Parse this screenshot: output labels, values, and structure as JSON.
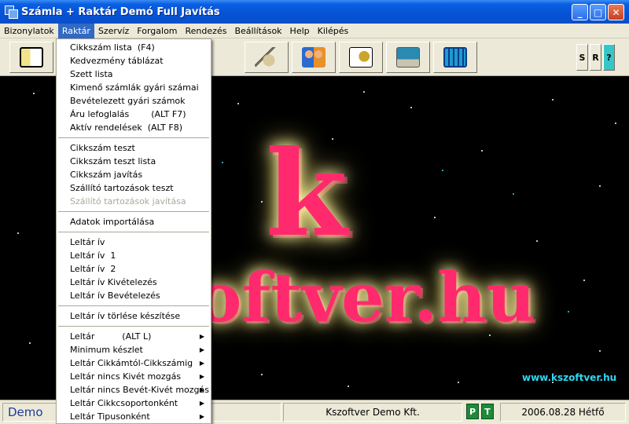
{
  "window": {
    "title": "Számla + Raktár Demó Full  Javítás"
  },
  "menubar": {
    "items": [
      "Bizonylatok",
      "Raktár",
      "Szervíz",
      "Forgalom",
      "Rendezés",
      "Beállítások",
      "Help",
      "Kilépés"
    ],
    "active": "Raktár"
  },
  "toolbar": {
    "buttons": [
      "folder-list-icon",
      "books-icon",
      "saxophone-icon",
      "users-icon",
      "gears-shortcut-icon",
      "computer-icon",
      "calculator-icon"
    ],
    "small_buttons": [
      "S",
      "R",
      "?"
    ]
  },
  "raktar_menu": {
    "group1": [
      "Cikkszám lista  (F4)",
      "Kedvezmény táblázat",
      "Szett lista",
      "Kimenő számlák gyári számai",
      "Bevételezett gyári számok",
      "Áru lefoglalás        (ALT F7)",
      "Aktív rendelések  (ALT F8)"
    ],
    "group2": [
      "Cikkszám teszt",
      "Cikkszám teszt lista",
      "Cikkszám javítás",
      "Szállító tartozások teszt"
    ],
    "group2_disabled": "Szállító tartozások javítása",
    "group3": [
      "Adatok importálása"
    ],
    "group4": [
      "Leltár ív",
      "Leltár ív  1",
      "Leltár ív  2",
      "Leltár ív Kivételezés",
      "Leltár ív Bevételezés"
    ],
    "group5": [
      "Leltár ív törlése készítése"
    ],
    "group6": [
      "Leltár          (ALT L)",
      "Minimum készlet",
      "Leltár Cikkámtól-Cikkszámig",
      "Leltár nincs Kivét mozgás",
      "Leltár nincs Bevét-Kivét mozgás",
      "Leltár Cikkcsoportonként",
      "Leltár Tipusonként"
    ]
  },
  "canvas": {
    "logo_k": "k",
    "logo_rest": "oftver.hu",
    "website": "www.kszoftver.hu"
  },
  "statusbar": {
    "mode": "Demo",
    "company": "Kszoftver Demo Kft.",
    "p": "P",
    "t": "T",
    "date": "2006.08.28 Hétfő"
  },
  "colors": {
    "titlebar": "#0552d6",
    "menu_highlight": "#316ac5",
    "logo_pink": "#ff2a6d",
    "link_cyan": "#2fd8f2"
  }
}
